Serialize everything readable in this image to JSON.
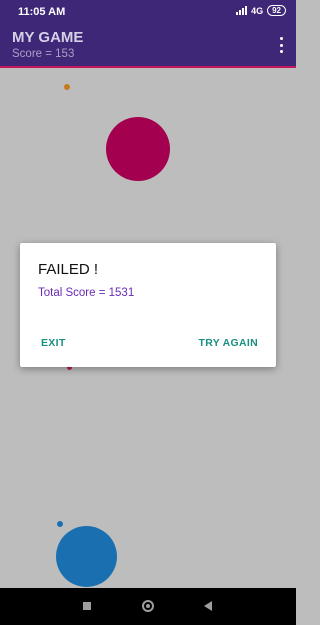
{
  "status_bar": {
    "time": "11:05 AM",
    "network": "4G",
    "battery": "92",
    "icons": [
      "signal-icon",
      "battery-icon"
    ]
  },
  "app_bar": {
    "title": "MY GAME",
    "subtitle": "Score = 153",
    "menu_icon": "more-vert-icon"
  },
  "game_area": {
    "colors": {
      "background": "#bdbdbd",
      "orange_dot": "#c87a1e",
      "magenta_ball": "#a3004f",
      "red_dot": "#c2185b",
      "blue_dot": "#1a6fb0",
      "blue_ball": "#1a6fb0"
    }
  },
  "dialog": {
    "title": "FAILED !",
    "message": "Total Score = 1531",
    "exit_label": "EXIT",
    "retry_label": "TRY AGAIN"
  },
  "nav_bar": {
    "icons": [
      "recents-icon",
      "home-icon",
      "back-icon"
    ]
  },
  "colors": {
    "app_bar": "#3f2777",
    "accent_line": "#c2185b",
    "dialog_button": "#1b9080",
    "dialog_message": "#6a2bb5"
  }
}
